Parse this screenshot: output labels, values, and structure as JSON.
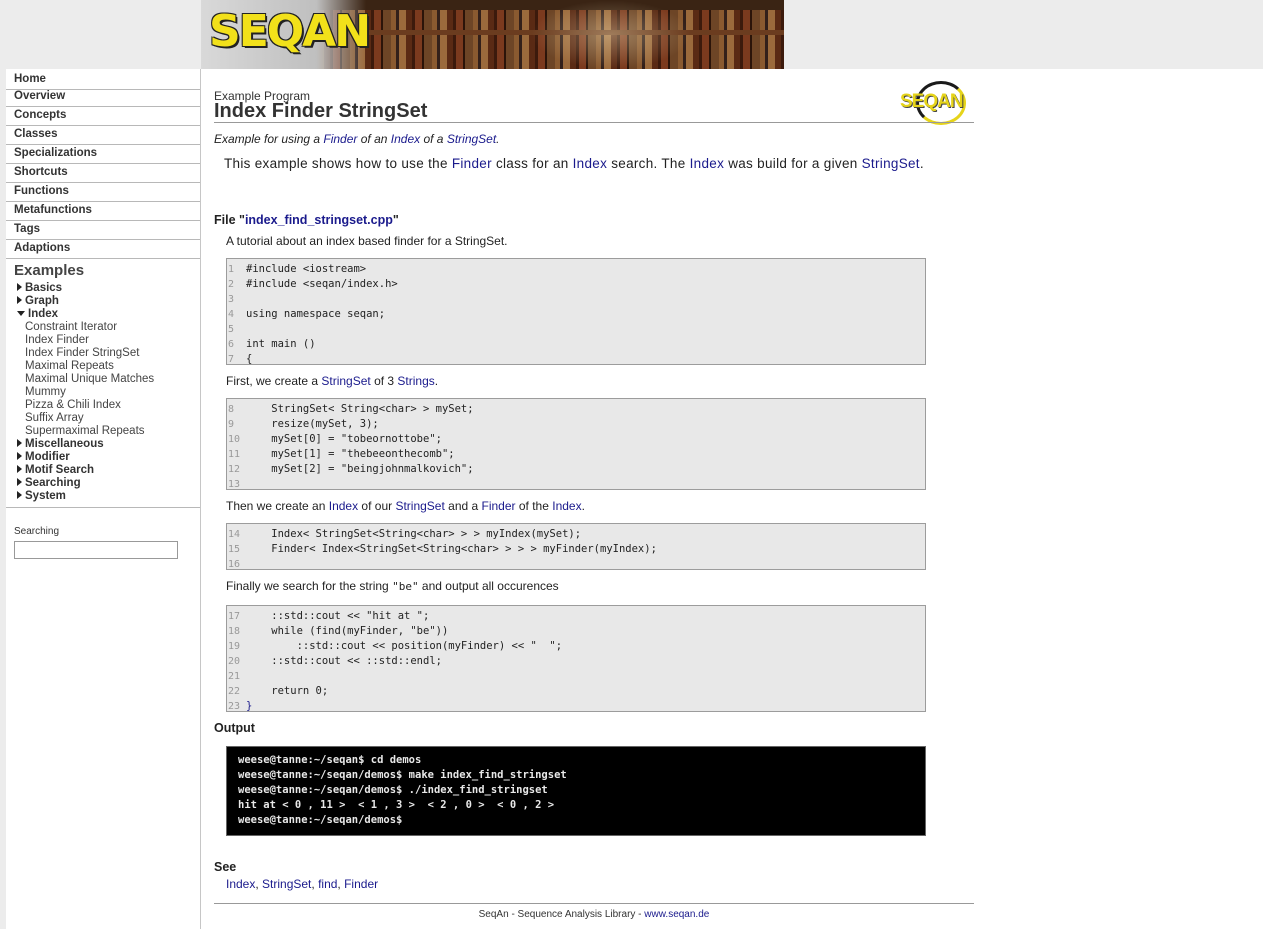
{
  "banner": {
    "logo_text": "SEQAN"
  },
  "nav": {
    "items": [
      {
        "label": "Home"
      },
      {
        "label": "Overview"
      },
      {
        "label": "Concepts"
      },
      {
        "label": "Classes"
      },
      {
        "label": "Specializations"
      },
      {
        "label": "Shortcuts"
      },
      {
        "label": "Functions"
      },
      {
        "label": "Metafunctions"
      },
      {
        "label": "Tags"
      },
      {
        "label": "Adaptions"
      }
    ],
    "examples_title": "Examples",
    "categories": [
      {
        "label": "Basics",
        "expanded": false
      },
      {
        "label": "Graph",
        "expanded": false
      },
      {
        "label": "Index",
        "expanded": true
      },
      {
        "label": "Miscellaneous",
        "expanded": false
      },
      {
        "label": "Modifier",
        "expanded": false
      },
      {
        "label": "Motif Search",
        "expanded": false
      },
      {
        "label": "Searching",
        "expanded": false
      },
      {
        "label": "System",
        "expanded": false
      }
    ],
    "index_items": [
      "Constraint Iterator",
      "Index Finder",
      "Index Finder StringSet",
      "Maximal Repeats",
      "Maximal Unique Matches",
      "Mummy",
      "Pizza & Chili Index",
      "Suffix Array",
      "Supermaximal Repeats"
    ],
    "search_label": "Searching",
    "search_value": ""
  },
  "page": {
    "kicker": "Example Program",
    "title": "Index Finder StringSet",
    "logo_text": "SEQAN",
    "summary": {
      "pre": "Example for using a ",
      "link1": "Finder",
      "mid1": " of an ",
      "link2": "Index",
      "mid2": " of a ",
      "link3": "StringSet",
      "post": "."
    },
    "intro": {
      "t1": "This example shows how to use the ",
      "l1": "Finder",
      "t2": " class for an ",
      "l2": "Index",
      "t3": " search. The ",
      "l3": "Index",
      "t4": " was build for a given ",
      "l4": "StringSet",
      "t5": "."
    },
    "file_heading_pre": "File \"",
    "file_heading_link": "index_find_stringset.cpp",
    "file_heading_post": "\"",
    "file_desc": "A tutorial about an index based finder for a StringSet.",
    "p1": {
      "t1": "First, we create a ",
      "l1": "StringSet",
      "t2": " of 3 ",
      "l2": "Strings",
      "t3": "."
    },
    "p2": {
      "t1": "Then we create an ",
      "l1": "Index",
      "t2": " of our ",
      "l2": "StringSet",
      "t3": " and a ",
      "l3": "Finder",
      "t4": " of the ",
      "l4": "Index",
      "t5": "."
    },
    "p3": {
      "t1": "Finally we search for the string ",
      "code": "\"be\"",
      "t2": " and output all occurences"
    },
    "code_blocks": [
      [
        {
          "n": "1",
          "s": "#include <iostream>"
        },
        {
          "n": "2",
          "s": "#include <seqan/index.h>"
        },
        {
          "n": "3",
          "s": ""
        },
        {
          "n": "4",
          "s": "using namespace seqan;"
        },
        {
          "n": "5",
          "s": ""
        },
        {
          "n": "6",
          "s": "int main ()"
        },
        {
          "n": "7",
          "s": "{"
        }
      ],
      [
        {
          "n": "8",
          "s": "    StringSet< String<char> > mySet;"
        },
        {
          "n": "9",
          "s": "    resize(mySet, 3);"
        },
        {
          "n": "10",
          "s": "    mySet[0] = \"tobeornottobe\";"
        },
        {
          "n": "11",
          "s": "    mySet[1] = \"thebeeonthecomb\";"
        },
        {
          "n": "12",
          "s": "    mySet[2] = \"beingjohnmalkovich\";"
        },
        {
          "n": "13",
          "s": ""
        }
      ],
      [
        {
          "n": "14",
          "s": "    Index< StringSet<String<char> > > myIndex(mySet);"
        },
        {
          "n": "15",
          "s": "    Finder< Index<StringSet<String<char> > > > myFinder(myIndex);"
        },
        {
          "n": "16",
          "s": ""
        }
      ],
      [
        {
          "n": "17",
          "s": "    ::std::cout << \"hit at \";"
        },
        {
          "n": "18",
          "s": "    while (find(myFinder, \"be\"))"
        },
        {
          "n": "19",
          "s": "        ::std::cout << position(myFinder) << \"  \";"
        },
        {
          "n": "20",
          "s": "    ::std::cout << ::std::endl;"
        },
        {
          "n": "21",
          "s": ""
        },
        {
          "n": "22",
          "s": "    return 0;"
        },
        {
          "n": "23",
          "s": "}"
        }
      ]
    ],
    "output_heading": "Output",
    "terminal_lines": [
      "weese@tanne:~/seqan$ cd demos",
      "weese@tanne:~/seqan/demos$ make index_find_stringset",
      "weese@tanne:~/seqan/demos$ ./index_find_stringset",
      "hit at < 0 , 11 >  < 1 , 3 >  < 2 , 0 >  < 0 , 2 >",
      "weese@tanne:~/seqan/demos$"
    ],
    "see_heading": "See",
    "see_links": [
      "Index",
      "StringSet",
      "find",
      "Finder"
    ],
    "see_sep": ", ",
    "footer_text": "SeqAn - Sequence Analysis Library - ",
    "footer_link": "www.seqan.de"
  },
  "colors": {
    "link": "#1a1a8c",
    "code_bg": "#e8e8e8",
    "terminal_bg": "#000000",
    "logo_yellow": "#f2e11a"
  }
}
